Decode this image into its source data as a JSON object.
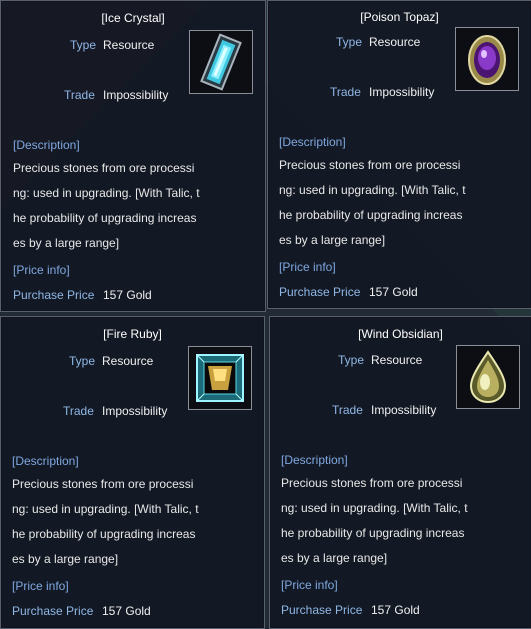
{
  "tooltips": [
    {
      "title": "[Ice Crystal]",
      "type_label": "Type",
      "type_value": "Resource",
      "trade_label": "Trade",
      "trade_value": "Impossibility",
      "desc_head": "[Description]",
      "desc_lines": [
        "Precious stones from ore processi",
        "ng: used in upgrading. [With Talic, t",
        "he probability of upgrading increas",
        "es by a large range]"
      ],
      "price_head": "[Price info]",
      "price_label": "Purchase Price",
      "price_value": "157 Gold",
      "icon": "ice-crystal-icon"
    },
    {
      "title": "[Poison Topaz]",
      "type_label": "Type",
      "type_value": "Resource",
      "trade_label": "Trade",
      "trade_value": "Impossibility",
      "desc_head": "[Description]",
      "desc_lines": [
        "Precious stones from ore processi",
        "ng: used in upgrading. [With Talic, t",
        "he probability of upgrading increas",
        "es by a large range]"
      ],
      "price_head": "[Price info]",
      "price_label": "Purchase Price",
      "price_value": "157 Gold",
      "icon": "poison-topaz-icon"
    },
    {
      "title": "[Fire Ruby]",
      "type_label": "Type",
      "type_value": "Resource",
      "trade_label": "Trade",
      "trade_value": "Impossibility",
      "desc_head": "[Description]",
      "desc_lines": [
        "Precious stones from ore processi",
        "ng: used in upgrading. [With Talic, t",
        "he probability of upgrading increas",
        "es by a large range]"
      ],
      "price_head": "[Price info]",
      "price_label": "Purchase Price",
      "price_value": "157 Gold",
      "icon": "fire-ruby-icon"
    },
    {
      "title": "[Wind Obsidian]",
      "type_label": "Type",
      "type_value": "Resource",
      "trade_label": "Trade",
      "trade_value": "Impossibility",
      "desc_head": "[Description]",
      "desc_lines": [
        "Precious stones from ore processi",
        "ng: used in upgrading. [With Talic, t",
        "he probability of upgrading increas",
        "es by a large range]"
      ],
      "price_head": "[Price info]",
      "price_label": "Purchase Price",
      "price_value": "157 Gold",
      "icon": "wind-obsidian-icon"
    }
  ],
  "colors": {
    "label": "#8fb7e6",
    "heading": "#7fa8e0",
    "text": "#e8e8e8",
    "border": "#59606f"
  }
}
